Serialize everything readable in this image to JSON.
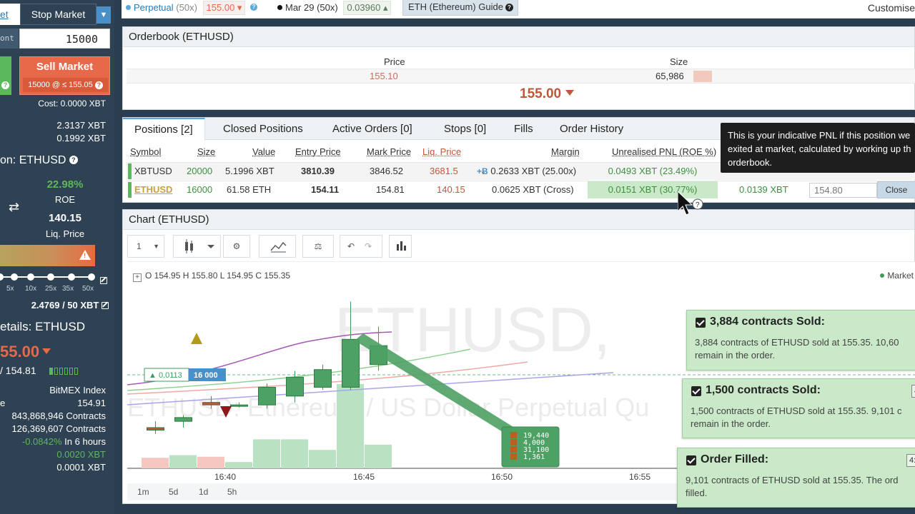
{
  "sidebar": {
    "tab_market": "et",
    "tab_stop": "Stop Market",
    "qty_label": "ont",
    "qty_value": "15000",
    "sell_label": "Sell Market",
    "sell_sub": "15000 @ ≤ 155.05",
    "cost": "Cost: 0.0000 XBT",
    "balance_1": "2.3137 XBT",
    "balance_2": "0.1992 XBT",
    "position_title": "on: ETHUSD",
    "roe_value": "22.98%",
    "roe_label": "ROE",
    "liq_value": "140.15",
    "liq_label": "Liq. Price",
    "leverage_labels": [
      "5x",
      "10x",
      "25x",
      "35x",
      "50x"
    ],
    "margin_text": "2.4769 / 50 XBT",
    "details_title": "etails: ETHUSD",
    "last_price": "55.00",
    "mark_price": "/ 154.81",
    "index_label": "BitMEX Index",
    "details": [
      {
        "label": "e",
        "value": "154.91"
      },
      {
        "label": "",
        "value": "843,868,946 Contracts"
      },
      {
        "label": "",
        "value": "126,369,607 Contracts"
      },
      {
        "label": "",
        "value": "-0.0842% In 6 hours"
      },
      {
        "label": "",
        "value": "0.0020 XBT"
      },
      {
        "label": "",
        "value": "0.0001 XBT"
      }
    ],
    "funding_rate": "-0.0842%",
    "funding_time": "In 6 hours"
  },
  "topbar": {
    "perpetual_label": "Perpetual",
    "perpetual_leverage": "(50x)",
    "perpetual_price": "155.00",
    "march_label": "Mar 29",
    "march_leverage": "(50x)",
    "march_price": "0.03960",
    "guide_label": "ETH (Ethereum) Guide",
    "customise_label": "Customise"
  },
  "orderbook": {
    "title": "Orderbook (ETHUSD)",
    "col_price": "Price",
    "col_size": "Size",
    "row_price": "155.10",
    "row_size": "65,986",
    "last_price": "155.00"
  },
  "positions": {
    "tabs": [
      "Positions [2]",
      "Closed Positions",
      "Active Orders [0]",
      "Stops [0]",
      "Fills",
      "Order History"
    ],
    "columns": [
      "Symbol",
      "Size",
      "Value",
      "Entry Price",
      "Mark Price",
      "Liq. Price",
      "Margin",
      "Unrealised PNL (ROE %)"
    ],
    "rows": [
      {
        "symbol": "XBTUSD",
        "size": "20000",
        "value": "5.1996 XBT",
        "entry": "3810.39",
        "mark": "3846.52",
        "liq": "3681.5",
        "margin": "0.2633 XBT (25.00x)",
        "pnl": "0.0493 XBT (23.49%)"
      },
      {
        "symbol": "ETHUSD",
        "size": "16000",
        "value": "61.58 ETH",
        "entry": "154.11",
        "mark": "154.81",
        "liq": "140.15",
        "margin": "0.0625 XBT (Cross)",
        "pnl": "0.0151 XBT (30.77%)",
        "realised": "0.0139 XBT",
        "close_price": "154.80",
        "close_label": "Close"
      }
    ]
  },
  "tooltip": {
    "lines": [
      "This is your indicative PNL if this position we",
      "exited at market, calculated by working up th",
      "orderbook."
    ]
  },
  "chart": {
    "title": "Chart (ETHUSD)",
    "interval": "1",
    "ohlc": "O 154.95  H 155.80  L 154.95  C 155.35",
    "legend": "Market C",
    "watermark_1": "ETHUSD,",
    "watermark_2": "ETHUSD: Ethereum / US Dollar Perpetual Qu",
    "x_ticks": [
      "16:40",
      "16:45",
      "16:50",
      "16:55"
    ],
    "timeframes": [
      "1m",
      "5d",
      "1d",
      "5h"
    ],
    "position_tag": "▲ 0.0113",
    "position_qty": "16 000",
    "fill_labels": [
      "19,440",
      "4,000",
      "31,100",
      "1,361"
    ]
  },
  "chart_data": {
    "type": "candlestick",
    "title": "Chart (ETHUSD)",
    "candles": [
      {
        "t": "16:38",
        "o": 154.8,
        "h": 154.85,
        "l": 154.75,
        "c": 154.78
      },
      {
        "t": "16:39",
        "o": 154.85,
        "h": 154.9,
        "l": 154.8,
        "c": 154.88
      },
      {
        "t": "16:40",
        "o": 155.0,
        "h": 155.05,
        "l": 154.95,
        "c": 154.98
      },
      {
        "t": "16:41",
        "o": 154.98,
        "h": 155.0,
        "l": 154.96,
        "c": 154.98
      },
      {
        "t": "16:42",
        "o": 154.98,
        "h": 155.15,
        "l": 154.95,
        "c": 155.12
      },
      {
        "t": "16:43",
        "o": 155.05,
        "h": 155.25,
        "l": 155.0,
        "c": 155.2
      },
      {
        "t": "16:44",
        "o": 155.12,
        "h": 155.3,
        "l": 155.1,
        "c": 155.26
      },
      {
        "t": "16:45",
        "o": 155.12,
        "h": 155.8,
        "l": 155.1,
        "c": 155.5
      },
      {
        "t": "16:46",
        "o": 155.3,
        "h": 155.6,
        "l": 155.25,
        "c": 155.45
      }
    ],
    "volume": [
      20,
      25,
      22,
      12,
      55,
      55,
      35,
      160,
      45
    ],
    "ylim": [
      154.5,
      156.0
    ]
  },
  "toasts": [
    {
      "title": "3,884 contracts Sold:",
      "body1": "3,884 contracts of ETHUSD sold at 155.35. 10,60",
      "body2": "remain in the order.",
      "time": "4:"
    },
    {
      "title": "1,500 contracts Sold:",
      "body1": "1,500 contracts of ETHUSD sold at 155.35. 9,101 c",
      "body2": "remain in the order.",
      "time": "4:"
    },
    {
      "title": "Order Filled:",
      "body1": "9,101 contracts of ETHUSD sold at 155.35. The ord",
      "body2": "filled.",
      "time": "4:"
    }
  ],
  "colors": {
    "buy": "#5cb85c",
    "sell": "#e8694a",
    "sidebar_bg": "#2f4254",
    "accent": "#4a90c8"
  }
}
